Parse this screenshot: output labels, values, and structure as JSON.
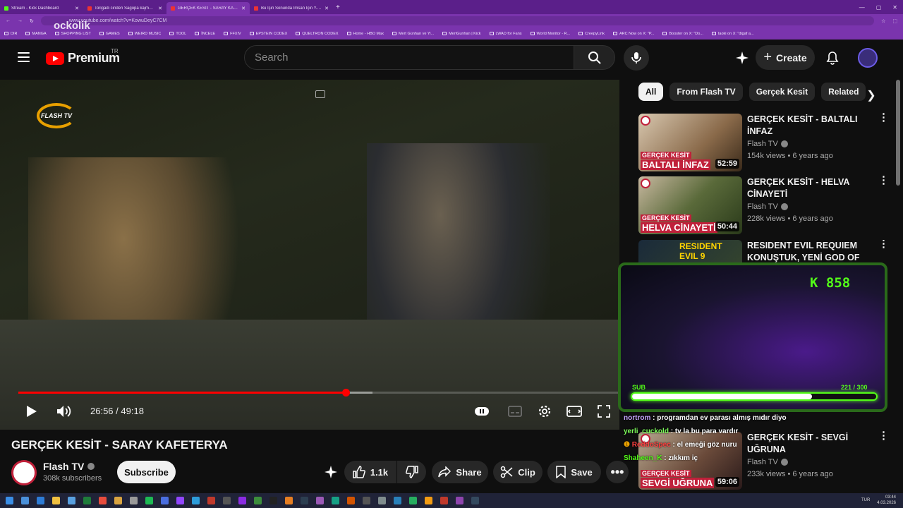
{
  "browser": {
    "tabs": [
      {
        "title": "Stream - Kick Dashboard",
        "active": false,
        "favicon": "kick"
      },
      {
        "title": "Torigadi cinderi Sagopa kajmer es",
        "active": false,
        "favicon": "youtube"
      },
      {
        "title": "GERÇEK KESİT - SARAY KAFETERY",
        "active": true,
        "favicon": "youtube"
      },
      {
        "title": "Bu İşin Sonunda İmsan İçin Y.kim Y",
        "active": false,
        "favicon": "youtube"
      }
    ],
    "url": "www.youtube.com/watch?v=KowuDeyC7CM",
    "watermark": "ockolik",
    "bookmarks": [
      "DIR",
      "MANGA",
      "SHOPPING LIST",
      "GAMES",
      "WEIRD MUSIC",
      "TOOL",
      "İNCELE",
      "FFXIV",
      "EPSTEIN CODEX",
      "QUELTRON CODEX",
      "Home - HBO Max",
      "Mert Günhan ve Yi...",
      "MertGunhan | Kick",
      "LWAD for Fans",
      "World Monitor - R...",
      "CreepyLink",
      "ARC Now on X: \"P...",
      "Booster on X: \"Do...",
      "taoki on X: \"digaf a..."
    ]
  },
  "header": {
    "logo_text": "Premium",
    "region": "TR",
    "search_placeholder": "Search",
    "create_label": "Create"
  },
  "player": {
    "channel_watermark": "FLASH TV",
    "current_time": "26:56",
    "separator": "/",
    "duration": "49:18",
    "progress_fraction": 0.546,
    "buffered_fraction": 0.59
  },
  "video": {
    "title": "GERÇEK KESİT - SARAY KAFETERYA",
    "channel": "Flash TV",
    "subscribers": "308k subscribers",
    "subscribe_label": "Subscribe",
    "likes": "1.1k",
    "share_label": "Share",
    "clip_label": "Clip",
    "save_label": "Save"
  },
  "chips": [
    "All",
    "From Flash TV",
    "Gerçek Kesit",
    "Related"
  ],
  "recommendations": [
    {
      "title": "GERÇEK KESİT - BALTALI İNFAZ",
      "channel": "Flash TV",
      "meta": "154k views • 6 years ago",
      "duration": "52:59",
      "thumb_small": "GERÇEK KESİT",
      "thumb_big": "BALTALI İNFAZ"
    },
    {
      "title": "GERÇEK KESİT - HELVA CİNAYETİ",
      "channel": "Flash TV",
      "meta": "228k views • 6 years ago",
      "duration": "50:44",
      "thumb_small": "GERÇEK KESİT",
      "thumb_big": "HELVA CİNAYETİ"
    },
    {
      "title": "RESIDENT EVIL REQUIEM KONUŞTUK, YENİ GOD OF WA...",
      "channel": "",
      "meta": "",
      "duration": "",
      "thumb_small": "",
      "thumb_big": "RESIDENT EVIL 9"
    },
    {
      "title": "GERÇEK KESİT - SEVGİ UĞRUNA",
      "channel": "Flash TV",
      "meta": "233k views • 6 years ago",
      "duration": "59:06",
      "thumb_small": "GERÇEK KESİT",
      "thumb_big": "SEVGİ UĞRUNA"
    }
  ],
  "stream_overlay": {
    "kick_count": "K 858",
    "sub_label": "SUB",
    "sub_count": "221 / 300",
    "sub_fraction": 0.737
  },
  "chat": [
    {
      "user": "nortrom",
      "message": "programdan ev parası almış mıdır diyo",
      "color": "#c7a4ff"
    },
    {
      "user": "yerli_cuckold",
      "message": "tv la bu para vardır",
      "color": "#7cfc5a"
    },
    {
      "user": "ReddoSpec",
      "message": "el emeği göz nuru",
      "color": "#ff4040"
    },
    {
      "user": "Shaheen_K",
      "message": "zıkkım iç",
      "color": "#53fc18"
    }
  ],
  "taskbar": {
    "lang": "TUR",
    "time": "03:44",
    "date": "4.03.2026"
  },
  "colors": {
    "accent": "#ff0000",
    "browser": "#7a34ad",
    "kick_green": "#53fc18"
  }
}
